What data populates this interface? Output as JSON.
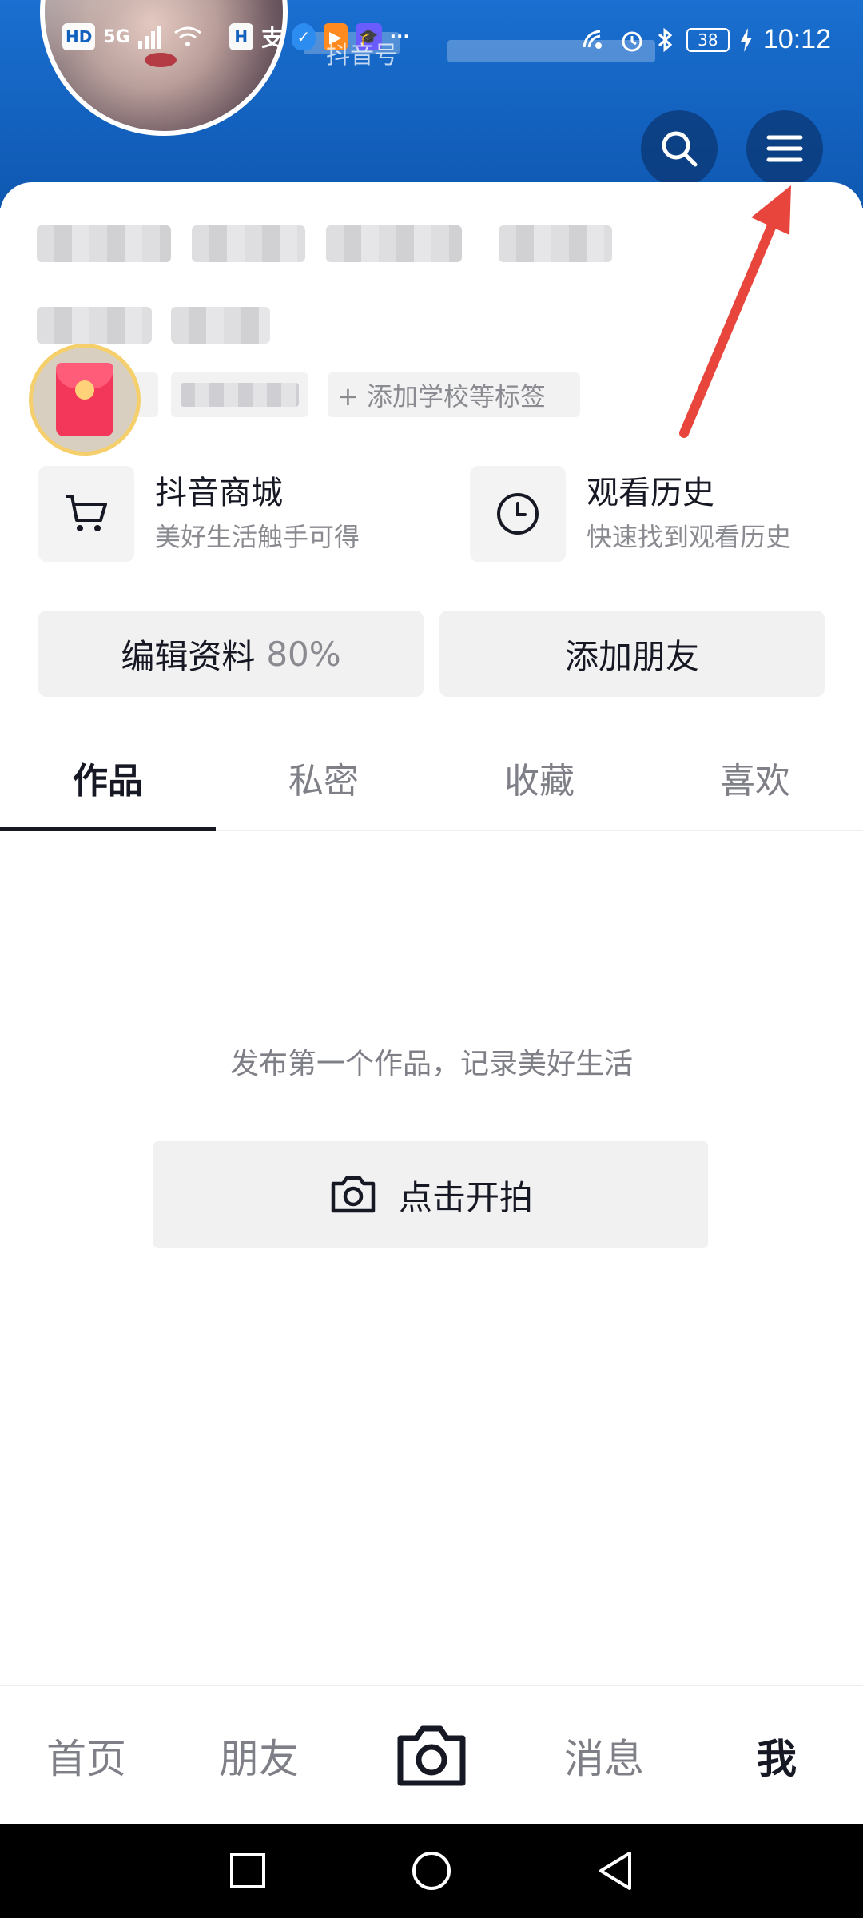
{
  "status_bar": {
    "hd_label": "HD",
    "network_label": "5G",
    "app_label_h": "H",
    "app_label_pay": "支",
    "battery": "38",
    "time": "10:12",
    "overlay_text": "抖音号"
  },
  "header": {
    "search_icon": "search-icon",
    "menu_icon": "menu-icon"
  },
  "profile": {
    "tags": [
      {
        "label": "岁"
      },
      {
        "label": ""
      }
    ],
    "add_tag_label": "+ 添加学校等标签"
  },
  "features": [
    {
      "icon": "cart-icon",
      "title": "抖音商城",
      "subtitle": "美好生活触手可得"
    },
    {
      "icon": "clock-icon",
      "title": "观看历史",
      "subtitle": "快速找到观看历史"
    }
  ],
  "actions": {
    "edit_profile": "编辑资料",
    "edit_progress": "80%",
    "add_friends": "添加朋友"
  },
  "tabs": [
    {
      "label": "作品",
      "active": true
    },
    {
      "label": "私密"
    },
    {
      "label": "收藏"
    },
    {
      "label": "喜欢"
    }
  ],
  "empty_state": {
    "message": "发布第一个作品，记录美好生活",
    "button_label": "点击开拍"
  },
  "bottom_nav": [
    {
      "label": "首页"
    },
    {
      "label": "朋友"
    },
    {
      "label": "",
      "icon": "camera-icon"
    },
    {
      "label": "消息"
    },
    {
      "label": "我",
      "active": true
    }
  ],
  "colors": {
    "header_blue": "#1361be",
    "annotation_red": "#e8453c",
    "text_primary": "#161823",
    "text_secondary": "#8a8b91"
  }
}
